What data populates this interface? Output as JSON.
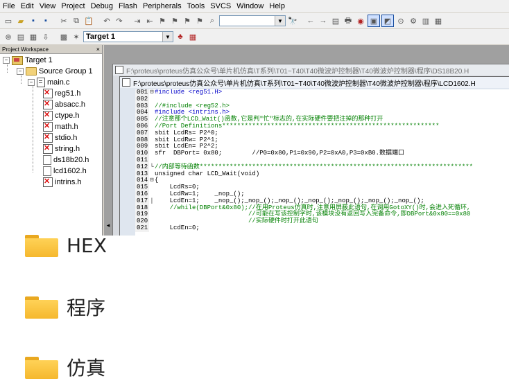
{
  "menubar": {
    "items": [
      {
        "label": "File"
      },
      {
        "label": "Edit"
      },
      {
        "label": "View"
      },
      {
        "label": "Project"
      },
      {
        "label": "Debug"
      },
      {
        "label": "Flash"
      },
      {
        "label": "Peripherals"
      },
      {
        "label": "Tools"
      },
      {
        "label": "SVCS"
      },
      {
        "label": "Window"
      },
      {
        "label": "Help"
      }
    ]
  },
  "toolbar2": {
    "target_select": "Target 1"
  },
  "workspace": {
    "title": "Project Workspace",
    "close": "×",
    "tree": {
      "target": "Target 1",
      "group": "Source Group 1",
      "main_file": "main.c",
      "headers": [
        "reg51.h",
        "absacc.h",
        "ctype.h",
        "math.h",
        "stdio.h",
        "string.h",
        "ds18b20.h",
        "lcd1602.h",
        "intrins.h"
      ]
    }
  },
  "windows": {
    "back_title": "F:\\proteus\\proteus仿真公众号\\单片机仿真\\T系列\\T01~T40\\T40微波炉控制器\\T40微波炉控制器\\程序\\DS18B20.H",
    "front_title": "F:\\proteus\\proteus仿真公众号\\单片机仿真\\T系列\\T01~T40\\T40微波炉控制器\\T40微波炉控制器\\程序\\LCD1602.H"
  },
  "code": [
    {
      "n": "001",
      "mk": "⊟",
      "text": "#include <reg51.H>",
      "cls": "c-blue"
    },
    {
      "n": "002",
      "mk": "",
      "text": "",
      "cls": "c-def"
    },
    {
      "n": "003",
      "mk": "",
      "text": "//#include <reg52.h>",
      "cls": "c-cmt"
    },
    {
      "n": "004",
      "mk": "",
      "text": "#include <intrins.h>",
      "cls": "c-blue"
    },
    {
      "n": "005",
      "mk": "",
      "text": "//注意那个LCD_Wait()函数,它是判\"忙\"标志的,在实际硬件要把注掉的那种打开",
      "cls": "c-cmt"
    },
    {
      "n": "006",
      "mk": "",
      "text": "//Port Definitions**********************************************************",
      "cls": "c-cmt"
    },
    {
      "n": "007",
      "mk": "",
      "text": "sbit LcdRs= P2^0;",
      "cls": "c-def"
    },
    {
      "n": "008",
      "mk": "",
      "text": "sbit LcdRw= P2^1;",
      "cls": "c-def"
    },
    {
      "n": "009",
      "mk": "",
      "text": "sbit LcdEn= P2^2;",
      "cls": "c-def"
    },
    {
      "n": "010",
      "mk": "",
      "text": "sfr  DBPort= 0x80;        //P0=0x80,P1=0x90,P2=0xA0,P3=0xB0.数据端口",
      "cls": "c-def"
    },
    {
      "n": "011",
      "mk": "",
      "text": "",
      "cls": "c-def"
    },
    {
      "n": "012",
      "mk": "└",
      "text": "//内部等待函数*************************************************************************",
      "cls": "c-cmt"
    },
    {
      "n": "013",
      "mk": "",
      "text": "unsigned char LCD_Wait(void)",
      "cls": "c-def"
    },
    {
      "n": "014",
      "mk": "⊟",
      "text": "{",
      "cls": "c-def"
    },
    {
      "n": "015",
      "mk": "",
      "text": "    LcdRs=0;",
      "cls": "c-def"
    },
    {
      "n": "016",
      "mk": "",
      "text": "    LcdRw=1;    _nop_();",
      "cls": "c-def"
    },
    {
      "n": "017",
      "mk": "|",
      "text": "    LcdEn=1;    _nop_();_nop_();_nop_();_nop_();_nop_();_nop_();_nop_();",
      "cls": "c-def"
    },
    {
      "n": "018",
      "mk": "",
      "text": "    //while(DBPort&0x80);//在用Proteus仿真时,注意用屏蔽此语句,在调用GotoXY()时,会进入死循环,",
      "cls": "c-cmt"
    },
    {
      "n": "019",
      "mk": "",
      "text": "                         //可能在写该控制字时,该模块没有返回写入完备命令,即DBPort&0x80==0x80",
      "cls": "c-cmt"
    },
    {
      "n": "020",
      "mk": "",
      "text": "                         //实际硬件时打开此语句",
      "cls": "c-cmt"
    },
    {
      "n": "021",
      "mk": "",
      "text": "    LcdEn=0;",
      "cls": "c-def"
    }
  ],
  "folders": [
    {
      "name": "HEX"
    },
    {
      "name": "程序"
    },
    {
      "name": "仿真"
    }
  ]
}
